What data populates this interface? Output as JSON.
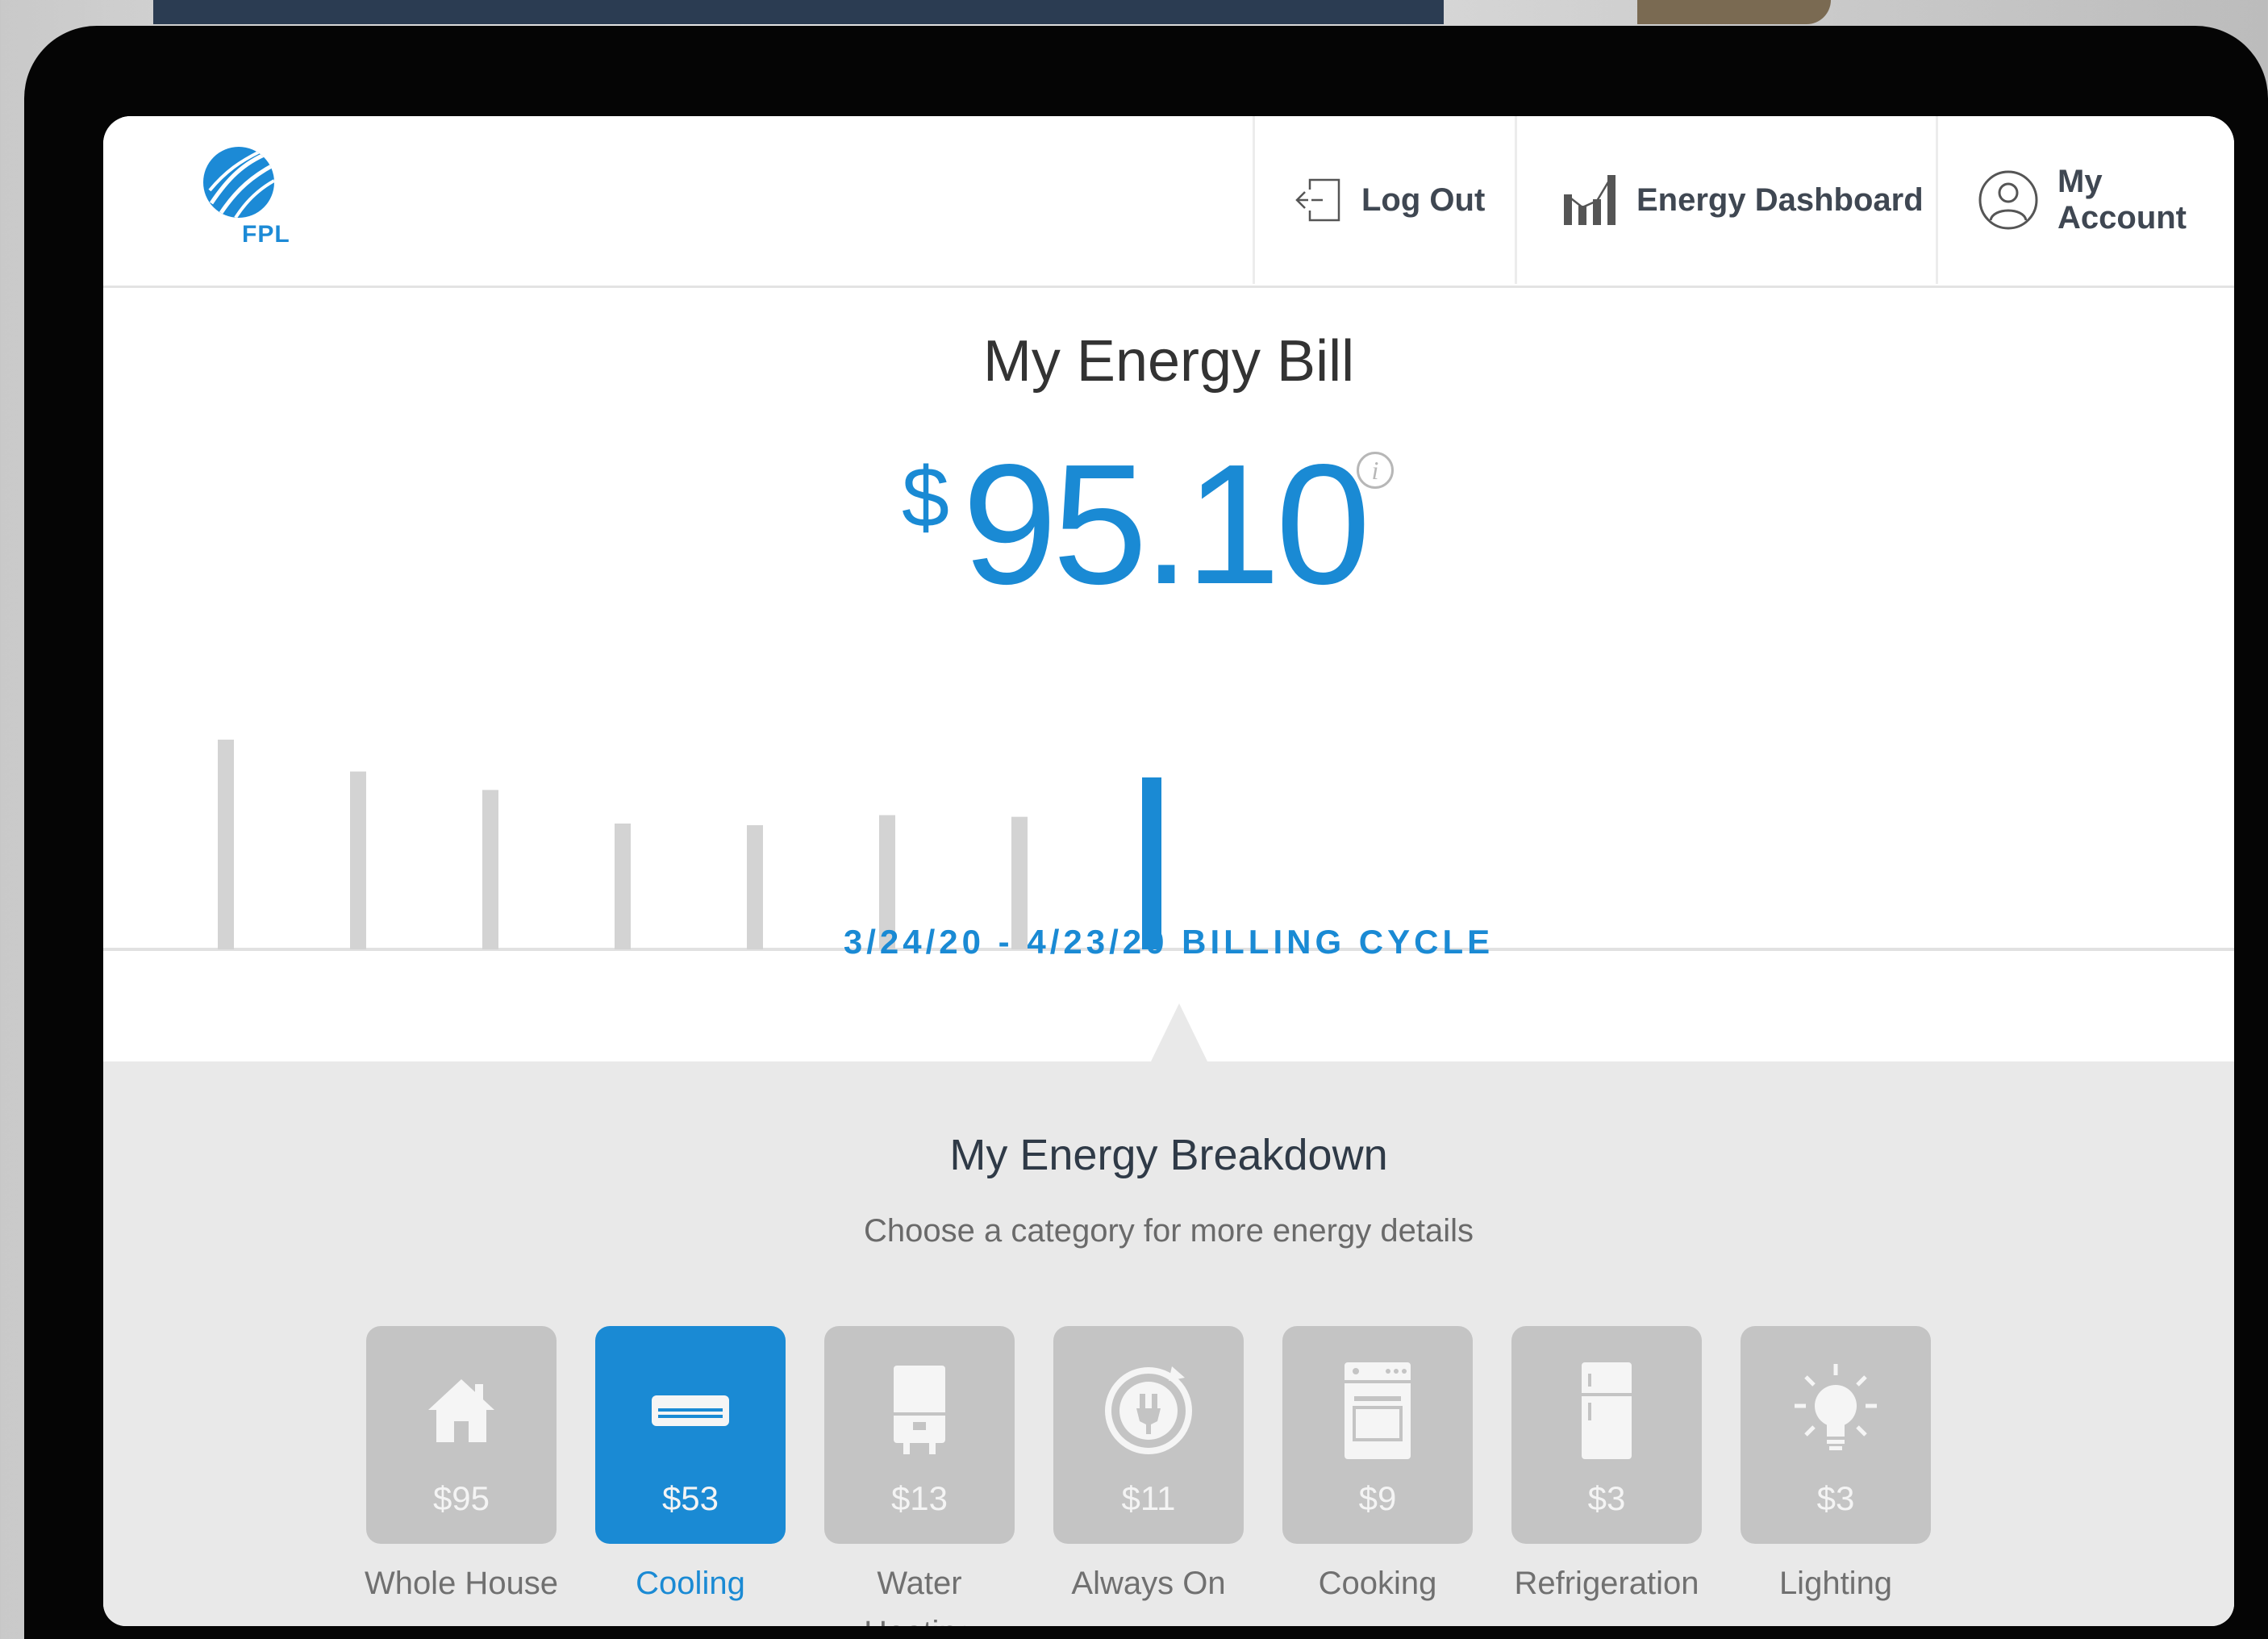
{
  "header": {
    "logo_text": "FPL",
    "logout_label": "Log Out",
    "dashboard_label": "Energy Dashboard",
    "account_label": "My Account"
  },
  "bill": {
    "title": "My Energy Bill",
    "currency": "$",
    "amount": "95.10",
    "info_icon": "i",
    "billing_cycle": "3/24/20 - 4/23/20 BILLING CYCLE"
  },
  "chart_data": {
    "type": "bar",
    "values": [
      250,
      212,
      190,
      150,
      148,
      160,
      158,
      205
    ],
    "highlight_index": 7,
    "colors": {
      "bar": "#d3d3d3",
      "highlight": "#1a8ad4"
    }
  },
  "breakdown": {
    "title": "My Energy Breakdown",
    "subtitle": "Choose a category for more energy details",
    "categories": [
      {
        "value": "$95",
        "label": "Whole House",
        "icon": "house-icon"
      },
      {
        "value": "$53",
        "label": "Cooling",
        "icon": "air-conditioner-icon",
        "active": true
      },
      {
        "value": "$13",
        "label": "Water",
        "label2": "Heating",
        "icon": "water-heater-icon"
      },
      {
        "value": "$11",
        "label": "Always On",
        "icon": "plug-icon"
      },
      {
        "value": "$9",
        "label": "Cooking",
        "icon": "oven-icon"
      },
      {
        "value": "$3",
        "label": "Refrigeration",
        "icon": "refrigerator-icon"
      },
      {
        "value": "$3",
        "label": "Lighting",
        "icon": "lightbulb-icon"
      }
    ]
  },
  "colors": {
    "brand_blue": "#1a8ad4",
    "panel_gray": "#e9e9e9",
    "tile_gray": "#c4c4c4"
  }
}
